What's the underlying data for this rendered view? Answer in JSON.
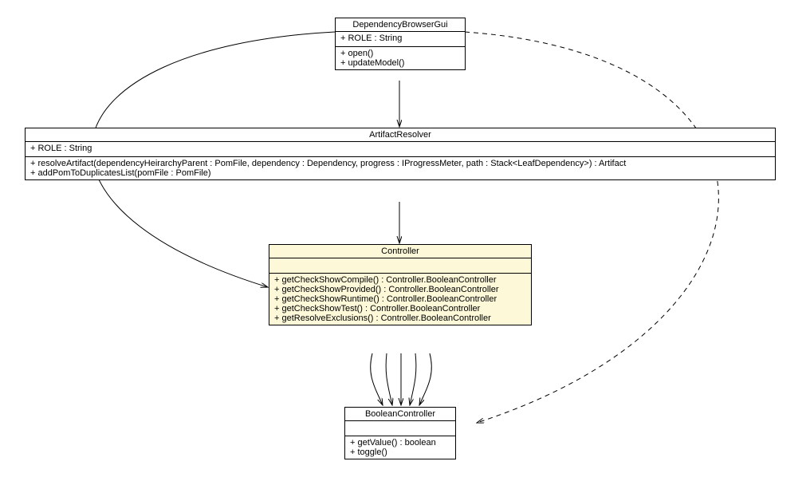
{
  "chart_data": {
    "type": "uml-class-diagram",
    "classes": [
      {
        "id": "DependencyBrowserGui",
        "attributes": [
          "+ ROLE : String"
        ],
        "methods": [
          "+ open()",
          "+ updateModel()"
        ]
      },
      {
        "id": "ArtifactResolver",
        "attributes": [
          "+ ROLE : String"
        ],
        "methods": [
          "+ resolveArtifact(dependencyHeirarchyParent : PomFile, dependency : Dependency, progress : IProgressMeter, path : Stack<LeafDependency>) : Artifact",
          "+ addPomToDuplicatesList(pomFile : PomFile)"
        ]
      },
      {
        "id": "Controller",
        "highlight": true,
        "attributes": [],
        "methods": [
          "+ getCheckShowCompile() : Controller.BooleanController",
          "+ getCheckShowProvided() : Controller.BooleanController",
          "+ getCheckShowRuntime() : Controller.BooleanController",
          "+ getCheckShowTest() : Controller.BooleanController",
          "+ getResolveExclusions() : Controller.BooleanController"
        ]
      },
      {
        "id": "BooleanController",
        "attributes": [],
        "methods": [
          "+ getValue() : boolean",
          "+ toggle()"
        ]
      }
    ],
    "relations": [
      {
        "from": "DependencyBrowserGui",
        "to": "ArtifactResolver",
        "style": "solid-arrow"
      },
      {
        "from": "ArtifactResolver",
        "to": "Controller",
        "style": "solid-arrow"
      },
      {
        "from": "DependencyBrowserGui",
        "to": "Controller",
        "style": "solid-arrow",
        "path": "curve-left"
      },
      {
        "from": "DependencyBrowserGui",
        "to": "BooleanController",
        "style": "dashed-arrow",
        "path": "curve-right"
      },
      {
        "from": "Controller",
        "to": "BooleanController",
        "style": "solid-arrow",
        "count": 5
      }
    ]
  },
  "classes": {
    "dep": {
      "title": "DependencyBrowserGui",
      "attr0": "+ ROLE : String",
      "m0": "+ open()",
      "m1": "+ updateModel()"
    },
    "art": {
      "title": "ArtifactResolver",
      "attr0": "+ ROLE : String",
      "m0": "+ resolveArtifact(dependencyHeirarchyParent : PomFile, dependency : Dependency, progress : IProgressMeter, path : Stack<LeafDependency>) : Artifact",
      "m1": "+ addPomToDuplicatesList(pomFile : PomFile)"
    },
    "ctrl": {
      "title": "Controller",
      "m0": "+ getCheckShowCompile() : Controller.BooleanController",
      "m1": "+ getCheckShowProvided() : Controller.BooleanController",
      "m2": "+ getCheckShowRuntime() : Controller.BooleanController",
      "m3": "+ getCheckShowTest() : Controller.BooleanController",
      "m4": "+ getResolveExclusions() : Controller.BooleanController"
    },
    "bool": {
      "title": "BooleanController",
      "m0": "+ getValue() : boolean",
      "m1": "+ toggle()"
    }
  }
}
